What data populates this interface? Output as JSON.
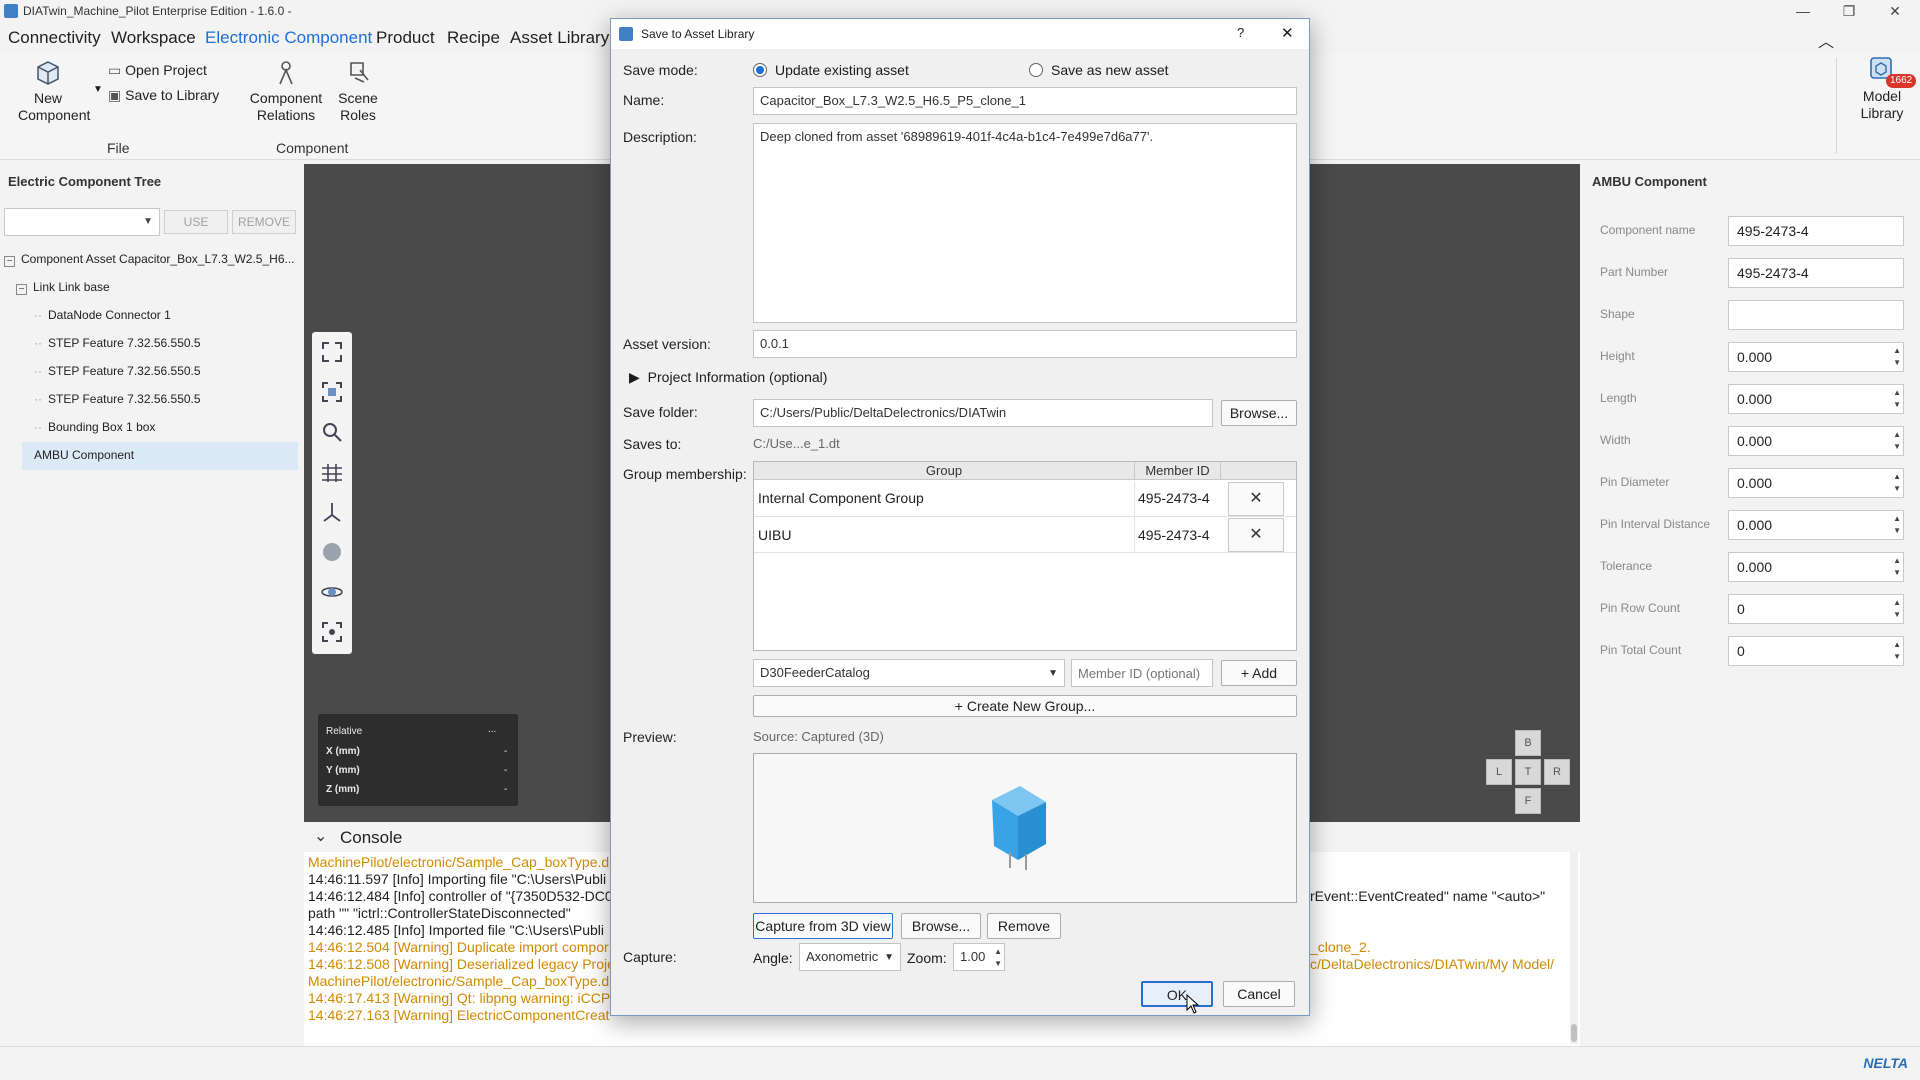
{
  "window": {
    "title": "DIATwin_Machine_Pilot Enterprise Edition - 1.6.0 -"
  },
  "menu": [
    "Connectivity",
    "Workspace",
    "Electronic Component",
    "Product",
    "Recipe",
    "Asset Library"
  ],
  "ribbon": {
    "new_component": "New Component",
    "open_project": "Open Project",
    "save_to_library": "Save to Library",
    "component_relations": "Component Relations",
    "scene_roles": "Scene Roles",
    "group_file": "File",
    "group_component": "Component",
    "model_library": "Model Library",
    "model_library_badge": "1662"
  },
  "tree": {
    "title": "Electric Component Tree",
    "use_btn": "USE",
    "remove_btn": "REMOVE",
    "items": [
      "Component Asset  Capacitor_Box_L7.3_W2.5_H6...",
      "Link  Link base",
      "DataNode  Connector 1",
      "STEP Feature  7.32.56.550.5",
      "STEP Feature  7.32.56.550.5",
      "STEP Feature  7.32.56.550.5",
      "Bounding Box  1 box",
      "AMBU Component"
    ]
  },
  "coords": {
    "title": "Relative",
    "menu": "...",
    "x": "X (mm)",
    "y": "Y (mm)",
    "z": "Z (mm)",
    "val": "-"
  },
  "navcube": {
    "b": "B",
    "l": "L",
    "t": "T",
    "r": "R",
    "f": "F"
  },
  "console": {
    "title": "Console",
    "lines": [
      "MachinePilot/electronic/Sample_Cap_boxType.d",
      "14:46:11.597 [Info] Importing file \"C:\\Users\\Publi",
      "14:46:12.484 [Info] controller of \"{7350D532-DC0",
      "path \"\" \"ictrl::ControllerStateDisconnected\"",
      "14:46:12.485 [Info] Imported file \"C:\\Users\\Publi",
      "14:46:12.504 [Warning] Duplicate import compor",
      "14:46:12.508 [Warning] Deserialized legacy Proje",
      "MachinePilot/electronic/Sample_Cap_boxType.d",
      "14:46:17.413 [Warning] Qt: libpng warning: iCCP:",
      "14:46:27.163 [Warning] ElectricComponentCreat"
    ],
    "right1": "rEvent::EventCreated\" name \"<auto>\"",
    "right2": "_clone_2.",
    "right3": "c/DeltaDelectronics/DIATwin/My Model/"
  },
  "props": {
    "title": "AMBU Component",
    "rows": [
      {
        "label": "Component name",
        "value": "495-2473-4"
      },
      {
        "label": "Part Number",
        "value": "495-2473-4"
      },
      {
        "label": "Shape",
        "value": ""
      },
      {
        "label": "Height",
        "value": "0.000"
      },
      {
        "label": "Length",
        "value": "0.000"
      },
      {
        "label": "Width",
        "value": "0.000"
      },
      {
        "label": "Pin Diameter",
        "value": "0.000"
      },
      {
        "label": "Pin Interval Distance",
        "value": "0.000"
      },
      {
        "label": "Tolerance",
        "value": "0.000"
      },
      {
        "label": "Pin Row Count",
        "value": "0"
      },
      {
        "label": "Pin Total Count",
        "value": "0"
      }
    ]
  },
  "dialog": {
    "title": "Save to Asset Library",
    "help": "?",
    "close": "✕",
    "save_mode_label": "Save mode:",
    "update_existing": "Update existing asset",
    "save_new": "Save as new asset",
    "name_label": "Name:",
    "name_value": "Capacitor_Box_L7.3_W2.5_H6.5_P5_clone_1",
    "desc_label": "Description:",
    "desc_value": "Deep cloned from asset '68989619-401f-4c4a-b1c4-7e499e7d6a77'.",
    "version_label": "Asset version:",
    "version_value": "0.0.1",
    "project_info": "Project Information (optional)",
    "folder_label": "Save folder:",
    "folder_value": "C:/Users/Public/DeltaDelectronics/DIATwin",
    "browse": "Browse...",
    "saves_to_label": "Saves to:",
    "saves_to_value": "C:/Use...e_1.dt",
    "group_label": "Group membership:",
    "col_group": "Group",
    "col_member": "Member ID",
    "groups": [
      {
        "name": "Internal Component Group",
        "member": "495-2473-4"
      },
      {
        "name": "UIBU",
        "member": "495-2473-4"
      }
    ],
    "group_select": "D30FeederCatalog",
    "member_placeholder": "Member ID (optional)",
    "add": "+ Add",
    "create_group": "+ Create New Group...",
    "preview_label": "Preview:",
    "preview_source": "Source: Captured (3D)",
    "capture_3d": "Capture from 3D view",
    "browse2": "Browse...",
    "remove": "Remove",
    "capture_label": "Capture:",
    "angle_label": "Angle:",
    "angle_value": "Axonometric",
    "zoom_label": "Zoom:",
    "zoom_value": "1.00",
    "ok": "OK",
    "cancel": "Cancel"
  },
  "status": {
    "logo": "NELTA"
  }
}
